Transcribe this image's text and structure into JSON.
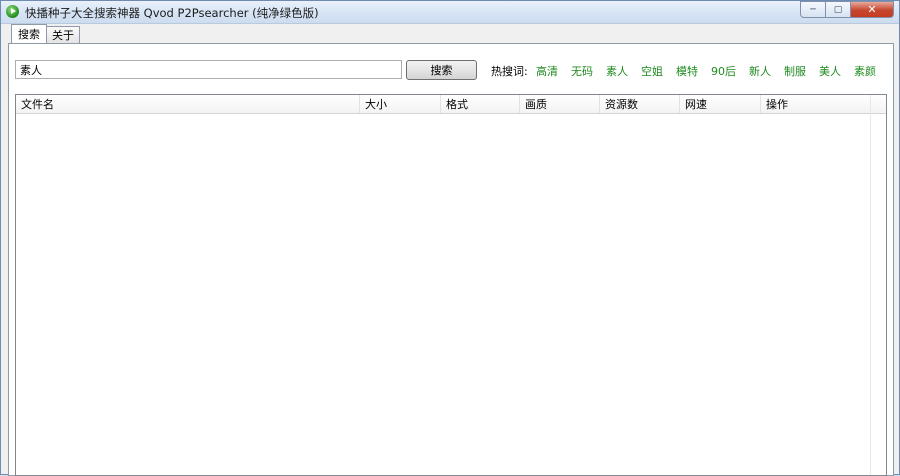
{
  "window": {
    "title": "快播种子大全搜索神器 Qvod P2Psearcher (纯净绿色版)",
    "min_glyph": "─",
    "max_glyph": "▢",
    "close_glyph": "✕"
  },
  "tabs": [
    {
      "label": "搜索",
      "active": true
    },
    {
      "label": "关于",
      "active": false
    }
  ],
  "search": {
    "value": "素人",
    "button_label": "搜索"
  },
  "hot": {
    "label": "热搜词:",
    "words": [
      "高清",
      "无码",
      "素人",
      "空姐",
      "模特",
      "90后",
      "新人",
      "制服",
      "美人",
      "素颜"
    ]
  },
  "table": {
    "columns": [
      "文件名",
      "大小",
      "格式",
      "画质",
      "资源数",
      "网速",
      "操作"
    ]
  },
  "colors": {
    "hot_word": "#1f8a1f",
    "close_button": "#c7462f"
  }
}
